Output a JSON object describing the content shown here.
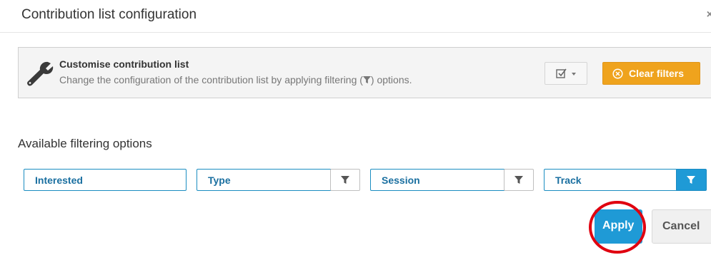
{
  "dialog": {
    "title": "Contribution list configuration",
    "close_glyph": "×"
  },
  "info": {
    "icon": "wrench-icon",
    "heading": "Customise contribution list",
    "text_before": "Change the configuration of the contribution list by applying filtering (",
    "text_after": ") options."
  },
  "toolbar": {
    "checkbox_menu_icon": "checkbox-icon",
    "clear_filters_label": "Clear filters",
    "clear_filters_color": "#efa31d"
  },
  "filters": {
    "section_label": "Available filtering options",
    "items": [
      {
        "label": "Interested",
        "has_filter_button": false,
        "active": false
      },
      {
        "label": "Type",
        "has_filter_button": true,
        "active": false
      },
      {
        "label": "Session",
        "has_filter_button": true,
        "active": false
      },
      {
        "label": "Track",
        "has_filter_button": true,
        "active": true
      }
    ],
    "accent_color": "#1f9ad6"
  },
  "actions": {
    "apply_label": "Apply",
    "cancel_label": "Cancel",
    "highlight_color": "#e0000f"
  }
}
